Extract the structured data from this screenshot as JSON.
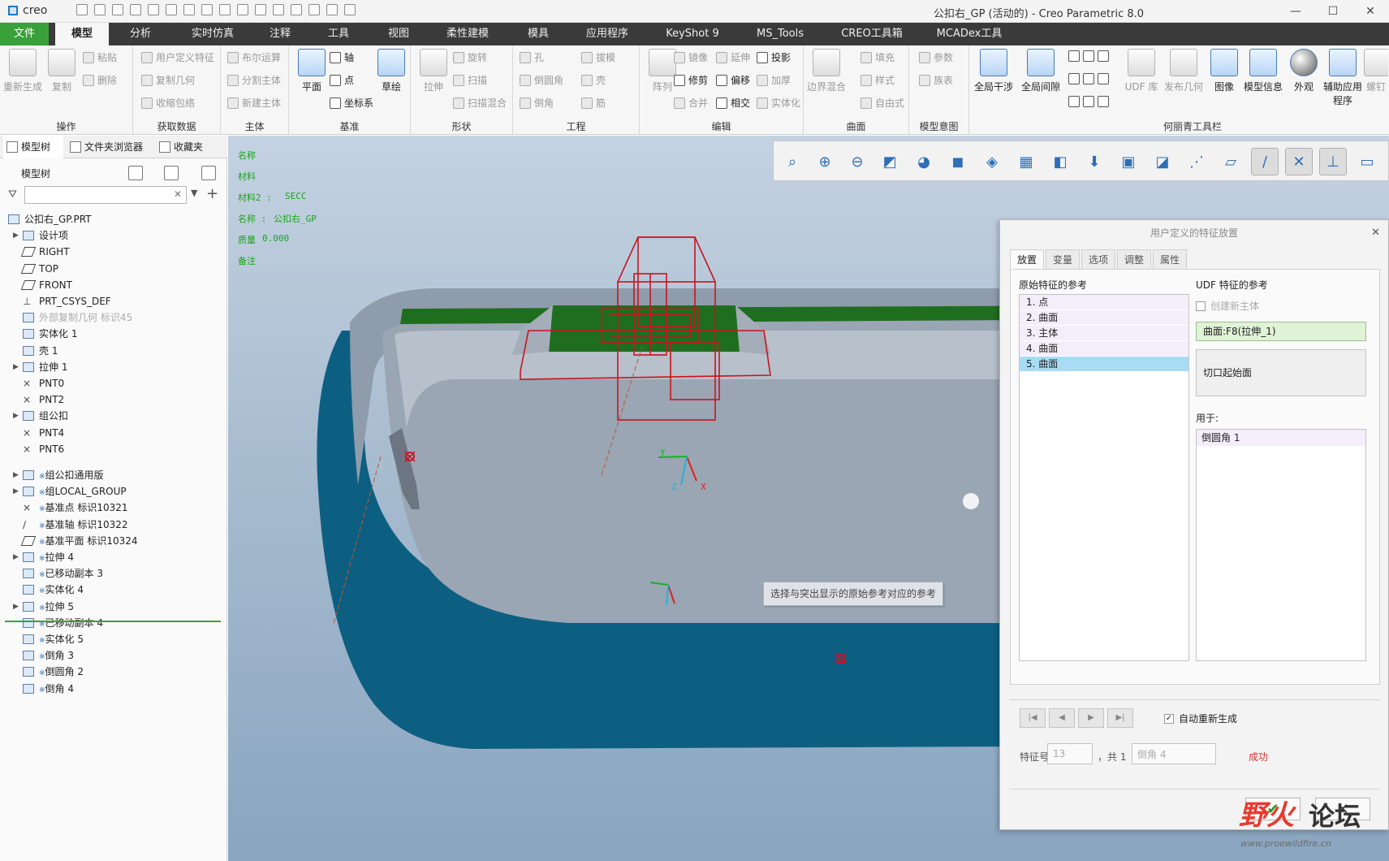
{
  "titlebar": {
    "logo": "creo",
    "title": "公扣右_GP (活动的) - Creo Parametric 8.0"
  },
  "menu": {
    "tabs": [
      "文件",
      "模型",
      "分析",
      "实时仿真",
      "注释",
      "工具",
      "视图",
      "柔性建模",
      "模具",
      "应用程序",
      "KeyShot 9",
      "MS_Tools",
      "CREO工具箱",
      "MCADex工具"
    ],
    "active": "模型"
  },
  "ribbon": {
    "groups": {
      "ops": "操作",
      "getdata": "获取数据",
      "body": "主体",
      "datum": "基准",
      "shape": "形状",
      "eng": "工程",
      "edit": "编辑",
      "surface": "曲面",
      "intent": "模型意图",
      "custom": "何丽青工具栏"
    },
    "items": {
      "regen": "重新生成",
      "copy": "复制",
      "paste": "粘贴",
      "delete": "删除",
      "udf": "用户定义特征",
      "copygeom": "复制几何",
      "shrinkwrap": "收缩包络",
      "boolean": "布尔运算",
      "splitbody": "分割主体",
      "newbody": "新建主体",
      "plane": "平面",
      "axis": "轴",
      "point": "点",
      "csys": "坐标系",
      "sketch": "草绘",
      "extrude": "拉伸",
      "revolve": "旋转",
      "sweep": "扫描",
      "sweptblend": "扫描混合",
      "hole": "孔",
      "round": "倒圆角",
      "chamfer": "倒角",
      "draft": "拔模",
      "shell": "壳",
      "rib": "筋",
      "pattern": "阵列",
      "mirror": "镜像",
      "trim": "修剪",
      "merge": "合并",
      "extend": "延伸",
      "offset": "偏移",
      "intersect": "相交",
      "project": "投影",
      "thicken": "加厚",
      "solidify": "实体化",
      "boundary": "边界混合",
      "fill": "填充",
      "style": "样式",
      "freestyle": "自由式",
      "params": "参数",
      "family": "族表",
      "globalint": "全局干涉",
      "globalclr": "全局间隙",
      "udflib": "UDF 库",
      "pubgeom": "发布几何",
      "image": "图像",
      "modelinfo": "模型信息",
      "appearance": "外观",
      "auxapp": "辅助应用程序",
      "bend": "螺钉"
    }
  },
  "leftpanel": {
    "tabs": [
      "模型树",
      "文件夹浏览器",
      "收藏夹"
    ],
    "tree_title": "模型树",
    "search_value": "",
    "tree": [
      {
        "label": "公扣右_GP.PRT",
        "exp": "",
        "icon": "part",
        "indent": 0,
        "grey": false
      },
      {
        "label": "设计项",
        "exp": "▶",
        "icon": "folder",
        "indent": 1,
        "grey": false
      },
      {
        "label": "RIGHT",
        "exp": "",
        "icon": "plane",
        "indent": 1,
        "grey": false
      },
      {
        "label": "TOP",
        "exp": "",
        "icon": "plane",
        "indent": 1,
        "grey": false
      },
      {
        "label": "FRONT",
        "exp": "",
        "icon": "plane",
        "indent": 1,
        "grey": false
      },
      {
        "label": "PRT_CSYS_DEF",
        "exp": "",
        "icon": "csys",
        "indent": 1,
        "grey": false
      },
      {
        "label": "外部复制几何 标识45",
        "exp": "",
        "icon": "copy",
        "indent": 1,
        "grey": true
      },
      {
        "label": "实体化 1",
        "exp": "",
        "icon": "solid",
        "indent": 1,
        "grey": false
      },
      {
        "label": "壳 1",
        "exp": "",
        "icon": "shell",
        "indent": 1,
        "grey": false
      },
      {
        "label": "拉伸 1",
        "exp": "▶",
        "icon": "extrude",
        "indent": 1,
        "grey": false
      },
      {
        "label": "PNT0",
        "exp": "",
        "icon": "point",
        "indent": 1,
        "grey": false
      },
      {
        "label": "PNT2",
        "exp": "",
        "icon": "point",
        "indent": 1,
        "grey": false
      },
      {
        "label": "组公扣",
        "exp": "▶",
        "icon": "group",
        "indent": 1,
        "grey": false
      },
      {
        "label": "PNT4",
        "exp": "",
        "icon": "point",
        "indent": 1,
        "grey": false
      },
      {
        "label": "PNT6",
        "exp": "",
        "icon": "point",
        "indent": 1,
        "grey": false
      },
      {
        "label": "组公扣通用版",
        "exp": "▶",
        "icon": "group",
        "indent": 1,
        "grey": false,
        "new": true
      },
      {
        "label": "组LOCAL_GROUP",
        "exp": "▶",
        "icon": "group",
        "indent": 1,
        "grey": false,
        "new": true
      },
      {
        "label": "基准点 标识10321",
        "exp": "",
        "icon": "point",
        "indent": 1,
        "grey": false,
        "new": true
      },
      {
        "label": "基准轴 标识10322",
        "exp": "",
        "icon": "axis",
        "indent": 1,
        "grey": false,
        "new": true
      },
      {
        "label": "基准平面 标识10324",
        "exp": "",
        "icon": "plane",
        "indent": 1,
        "grey": false,
        "new": true
      },
      {
        "label": "拉伸 4",
        "exp": "▶",
        "icon": "extrude",
        "indent": 1,
        "grey": false,
        "new": true
      },
      {
        "label": "已移动副本 3",
        "exp": "",
        "icon": "move",
        "indent": 1,
        "grey": false,
        "new": true
      },
      {
        "label": "实体化 4",
        "exp": "",
        "icon": "solid",
        "indent": 1,
        "grey": false,
        "new": true
      },
      {
        "label": "拉伸 5",
        "exp": "▶",
        "icon": "extrude",
        "indent": 1,
        "grey": false,
        "new": true
      },
      {
        "label": "已移动副本 4",
        "exp": "",
        "icon": "move",
        "indent": 1,
        "grey": false,
        "new": true
      },
      {
        "label": "实体化 5",
        "exp": "",
        "icon": "solid",
        "indent": 1,
        "grey": false,
        "new": true
      },
      {
        "label": "倒角 3",
        "exp": "",
        "icon": "chamfer",
        "indent": 1,
        "grey": false,
        "new": true
      },
      {
        "label": "倒圆角 2",
        "exp": "",
        "icon": "round",
        "indent": 1,
        "grey": false,
        "new": true
      },
      {
        "label": "倒角 4",
        "exp": "",
        "icon": "chamfer",
        "indent": 1,
        "grey": false,
        "new": true
      }
    ],
    "new_marker": "※"
  },
  "viewport": {
    "info": [
      {
        "key": "名称",
        "val": ""
      },
      {
        "key": "材料",
        "val": ""
      },
      {
        "key": "材料2 :",
        "val": "SECC"
      },
      {
        "key": "名称 :",
        "val": "公扣右_GP"
      },
      {
        "key": "质量",
        "val": "0.000"
      },
      {
        "key": "备注",
        "val": ""
      }
    ],
    "status_message": "选择与突出显示的原始参考对应的参考",
    "axis_labels": {
      "x": "X",
      "y": "Y",
      "z": "Z"
    }
  },
  "dialog": {
    "title": "用户定义的特征放置",
    "tabs": [
      "放置",
      "变量",
      "选项",
      "调整",
      "属性"
    ],
    "active_tab": "放置",
    "orig_refs_label": "原始特征的参考",
    "orig_refs": [
      "1. 点",
      "2. 曲面",
      "3. 主体",
      "4. 曲面",
      "5. 曲面"
    ],
    "selected_index": 4,
    "udf_refs_label": "UDF 特征的参考",
    "create_new_body": "创建新主体",
    "ref_value": "曲面:F8(拉伸_1)",
    "cut_start": "切口起始面",
    "used_for_label": "用于:",
    "used_for": [
      "倒圆角 1"
    ],
    "auto_regen": "自动重新生成",
    "feature_no_label": "特征号",
    "feature_no": "13",
    "total": "，共 1",
    "feature_name": "倒角 4",
    "result": "成功"
  },
  "watermark": {
    "text1": "野火",
    "text2": "论坛",
    "url": "www.proewildfire.cn"
  },
  "colors": {
    "file_tab": "#3aa03a",
    "menubar": "#3a3a3a",
    "model_green": "#1f6e1f",
    "model_teal": "#0d5f82",
    "udf_red": "#c8141e",
    "tree_separator": "#3aa03a",
    "success": "#dd3333"
  }
}
